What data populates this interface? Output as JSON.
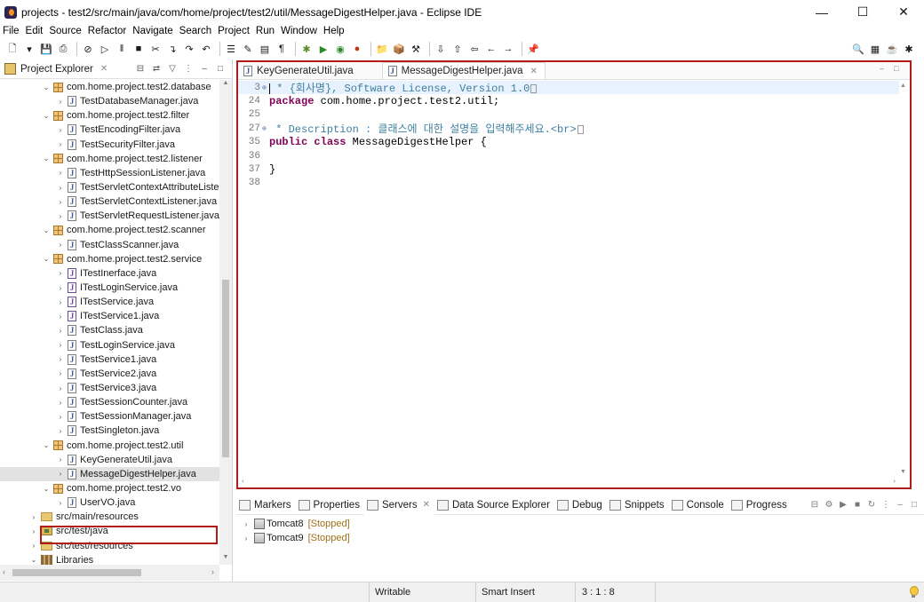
{
  "window": {
    "title": "projects - test2/src/main/java/com/home/project/test2/util/MessageDigestHelper.java - Eclipse IDE",
    "min_icon": "minimize-icon",
    "max_icon": "maximize-icon",
    "close_icon": "close-icon"
  },
  "menu": [
    "File",
    "Edit",
    "Source",
    "Refactor",
    "Navigate",
    "Search",
    "Project",
    "Run",
    "Window",
    "Help"
  ],
  "explorer": {
    "title": "Project Explorer",
    "tree": [
      {
        "label": "com.home.project.test2.database",
        "type": "package",
        "indent": 1,
        "expanded": true
      },
      {
        "label": "TestDatabaseManager.java",
        "type": "java",
        "indent": 2
      },
      {
        "label": "com.home.project.test2.filter",
        "type": "package",
        "indent": 1,
        "expanded": true
      },
      {
        "label": "TestEncodingFilter.java",
        "type": "java",
        "indent": 2
      },
      {
        "label": "TestSecurityFilter.java",
        "type": "java",
        "indent": 2
      },
      {
        "label": "com.home.project.test2.listener",
        "type": "package",
        "indent": 1,
        "expanded": true
      },
      {
        "label": "TestHttpSessionListener.java",
        "type": "java",
        "indent": 2
      },
      {
        "label": "TestServletContextAttributeListe",
        "type": "java",
        "indent": 2
      },
      {
        "label": "TestServletContextListener.java",
        "type": "java",
        "indent": 2
      },
      {
        "label": "TestServletRequestListener.java",
        "type": "java",
        "indent": 2
      },
      {
        "label": "com.home.project.test2.scanner",
        "type": "package",
        "indent": 1,
        "expanded": true
      },
      {
        "label": "TestClassScanner.java",
        "type": "java",
        "indent": 2
      },
      {
        "label": "com.home.project.test2.service",
        "type": "package",
        "indent": 1,
        "expanded": true
      },
      {
        "label": "ITestInerface.java",
        "type": "interface",
        "indent": 2
      },
      {
        "label": "ITestLoginService.java",
        "type": "interface",
        "indent": 2
      },
      {
        "label": "ITestService.java",
        "type": "interface",
        "indent": 2
      },
      {
        "label": "ITestService1.java",
        "type": "interface",
        "indent": 2
      },
      {
        "label": "TestClass.java",
        "type": "java",
        "indent": 2
      },
      {
        "label": "TestLoginService.java",
        "type": "java",
        "indent": 2
      },
      {
        "label": "TestService1.java",
        "type": "java",
        "indent": 2
      },
      {
        "label": "TestService2.java",
        "type": "java",
        "indent": 2
      },
      {
        "label": "TestService3.java",
        "type": "java",
        "indent": 2
      },
      {
        "label": "TestSessionCounter.java",
        "type": "java",
        "indent": 2
      },
      {
        "label": "TestSessionManager.java",
        "type": "java",
        "indent": 2
      },
      {
        "label": "TestSingleton.java",
        "type": "java",
        "indent": 2
      },
      {
        "label": "com.home.project.test2.util",
        "type": "package",
        "indent": 1,
        "expanded": true
      },
      {
        "label": "KeyGenerateUtil.java",
        "type": "java",
        "indent": 2
      },
      {
        "label": "MessageDigestHelper.java",
        "type": "java",
        "indent": 2,
        "selected": true
      },
      {
        "label": "com.home.project.test2.vo",
        "type": "package",
        "indent": 1,
        "expanded": true
      },
      {
        "label": "UserVO.java",
        "type": "java",
        "indent": 2
      },
      {
        "label": "src/main/resources",
        "type": "folder",
        "indent": 0
      },
      {
        "label": "src/test/java",
        "type": "srcfolder",
        "indent": 0
      },
      {
        "label": "src/test/resources",
        "type": "folder",
        "indent": 0
      },
      {
        "label": "Libraries",
        "type": "library",
        "indent": 0,
        "expanded": true
      }
    ]
  },
  "editor": {
    "tabs": [
      {
        "label": "KeyGenerateUtil.java",
        "active": false
      },
      {
        "label": "MessageDigestHelper.java",
        "active": true
      }
    ],
    "lines": [
      {
        "num": "3",
        "fold": "⊕",
        "current": true,
        "parts": [
          {
            "t": " * {회사명}, Software License, Version 1.0",
            "c": "cm"
          }
        ],
        "box": true
      },
      {
        "num": "24",
        "fold": "",
        "parts": [
          {
            "t": "package",
            "c": "kw"
          },
          {
            "t": " com.home.project.test2.util;",
            "c": "plain"
          }
        ]
      },
      {
        "num": "25",
        "fold": "",
        "parts": []
      },
      {
        "num": "27",
        "fold": "⊕",
        "parts": [
          {
            "t": " * Description : 클래스에 대한 설명을 입력해주세요.<br>",
            "c": "cm"
          }
        ],
        "box": true
      },
      {
        "num": "35",
        "fold": "",
        "parts": [
          {
            "t": "public",
            "c": "kw"
          },
          {
            "t": " ",
            "c": "plain"
          },
          {
            "t": "class",
            "c": "kw"
          },
          {
            "t": " MessageDigestHelper {",
            "c": "plain"
          }
        ]
      },
      {
        "num": "36",
        "fold": "",
        "parts": []
      },
      {
        "num": "37",
        "fold": "",
        "parts": [
          {
            "t": "}",
            "c": "plain"
          }
        ]
      },
      {
        "num": "38",
        "fold": "",
        "parts": []
      }
    ]
  },
  "bottom_panel": {
    "tabs": [
      {
        "label": "Markers",
        "icon": "markers-icon"
      },
      {
        "label": "Properties",
        "icon": "properties-icon"
      },
      {
        "label": "Servers",
        "icon": "servers-icon",
        "active": true
      },
      {
        "label": "Data Source Explorer",
        "icon": "data-source-icon"
      },
      {
        "label": "Debug",
        "icon": "debug-icon"
      },
      {
        "label": "Snippets",
        "icon": "snippets-icon"
      },
      {
        "label": "Console",
        "icon": "console-icon"
      },
      {
        "label": "Progress",
        "icon": "progress-icon"
      }
    ],
    "servers": [
      {
        "name": "Tomcat8",
        "status": "[Stopped]"
      },
      {
        "name": "Tomcat9",
        "status": "[Stopped]"
      }
    ]
  },
  "status": {
    "writable": "Writable",
    "insert_mode": "Smart Insert",
    "position": "3 : 1 : 8"
  }
}
